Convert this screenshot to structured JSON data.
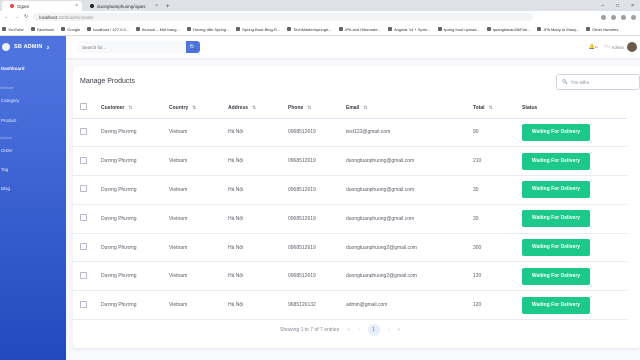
{
  "browser": {
    "tabs": [
      {
        "title": "Ogani",
        "close": "×"
      },
      {
        "title": "duongtuanphuong/ogani",
        "close": "×"
      }
    ],
    "new_tab": "+",
    "window_controls": [
      "–",
      "□",
      "×"
    ],
    "nav_buttons": [
      "←",
      "→",
      "↻"
    ],
    "url_host": "localhost",
    "url_path": ":4200/admin/order",
    "bookmarks": [
      "YouTube",
      "Facebook",
      "Google",
      "localhost / 127.0.0...",
      "thunuoi – Một trang...",
      "Hướng dẫn Spring...",
      "Spring-Boot-Blog-R...",
      "TechMaster/springb...",
      "JPA and Hibernate...",
      "Angular 14 + Sprin...",
      "spring boot upload...",
      "quangtiavan28/Flat...",
      "JPA Many to Many...",
      "Other favorites"
    ]
  },
  "sidebar": {
    "brand": "SB ADMIN",
    "brand_sup": "2",
    "headings": [
      "Interface",
      "Addons"
    ],
    "items": [
      {
        "label": "Dashboard"
      },
      {
        "label": "Category"
      },
      {
        "label": "Product"
      },
      {
        "label": "Order"
      },
      {
        "label": "Tag"
      },
      {
        "label": "Blog"
      }
    ]
  },
  "topbar": {
    "search_placeholder": "Search for...",
    "search_button": "🔍",
    "alerts_icon": "🔔",
    "alerts_badge": "3+",
    "messages_icon": "✉",
    "messages_badge": "7",
    "user_name": "Admin"
  },
  "products": {
    "title": "Manage Products",
    "search_placeholder": "Tìm kiếm",
    "search_icon": "🔍",
    "columns": [
      "Customer",
      "Country",
      "Address",
      "Phone",
      "Email",
      "Total",
      "Status"
    ],
    "sort_glyph": "⇅",
    "rows": [
      {
        "customer": "Dương Phương",
        "country": "Vietnam",
        "address": "Hà Nội",
        "phone": "0968512619",
        "email": "test123@gmail.com",
        "total": "90",
        "status": "Waiting For Delivery"
      },
      {
        "customer": "Dương Phương",
        "country": "Vietnam",
        "address": "Hà Nội",
        "phone": "0968512619",
        "email": "duongtuanphuong@gmail.com",
        "total": "210",
        "status": "Waiting For Delivery"
      },
      {
        "customer": "Dương Phương",
        "country": "Vietnam",
        "address": "Hà Nội",
        "phone": "0968512619",
        "email": "duongtuanphuong@gmail.com",
        "total": "30",
        "status": "Waiting For Delivery"
      },
      {
        "customer": "Dương Phương",
        "country": "Vietnam",
        "address": "Hà Nội",
        "phone": "0968512619",
        "email": "duongtuanphuong@gmail.com",
        "total": "30",
        "status": "Waiting For Delivery"
      },
      {
        "customer": "Dương Phương",
        "country": "Vietnam",
        "address": "Hà Nội",
        "phone": "0968512619",
        "email": "duongtuanphuong2@gmail.com",
        "total": "300",
        "status": "Waiting For Delivery"
      },
      {
        "customer": "Dương Phương",
        "country": "Vietnam",
        "address": "Hà Nội",
        "phone": "0968512619",
        "email": "duongtuanphuong2@gmail.com",
        "total": "120",
        "status": "Waiting For Delivery"
      },
      {
        "customer": "Dương Phương",
        "country": "Vietnam",
        "address": "Hà Nội",
        "phone": "9685126132",
        "email": "admin@gmail.com",
        "total": "120",
        "status": "Waiting For Delivery"
      }
    ],
    "pagination": {
      "summary": "Showing 1 to 7 of 7 entries",
      "first": "«",
      "prev": "‹",
      "current": "1",
      "next": "›",
      "last": "»"
    }
  },
  "colors": {
    "primary": "#4e73df",
    "success": "#1cc88a",
    "danger": "#e74a3b"
  }
}
